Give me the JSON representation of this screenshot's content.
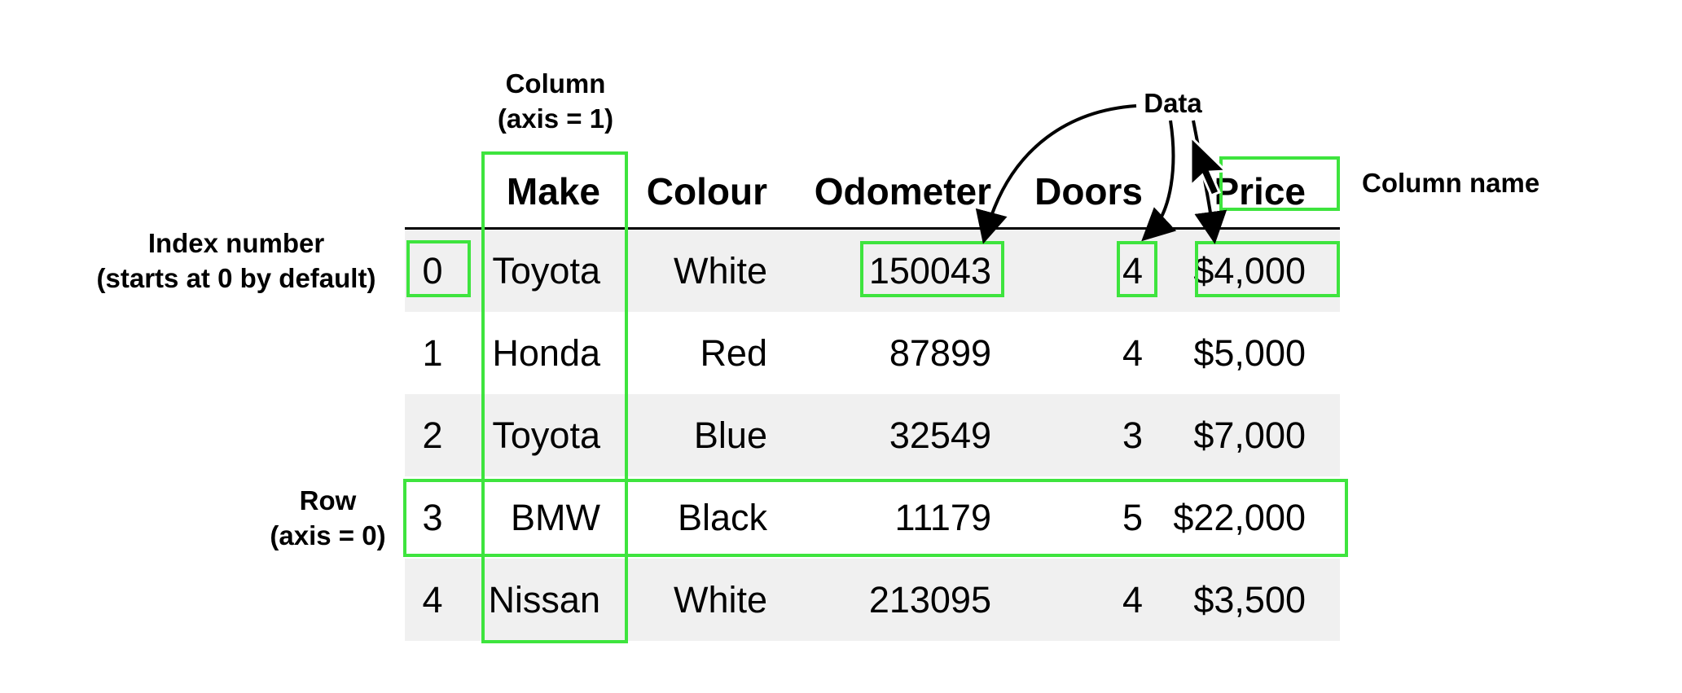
{
  "table": {
    "columns": [
      "Make",
      "Colour",
      "Odometer",
      "Doors",
      "Price"
    ],
    "rows": [
      {
        "index": "0",
        "make": "Toyota",
        "colour": "White",
        "odometer": "150043",
        "doors": "4",
        "price": "$4,000"
      },
      {
        "index": "1",
        "make": "Honda",
        "colour": "Red",
        "odometer": "87899",
        "doors": "4",
        "price": "$5,000"
      },
      {
        "index": "2",
        "make": "Toyota",
        "colour": "Blue",
        "odometer": "32549",
        "doors": "3",
        "price": "$7,000"
      },
      {
        "index": "3",
        "make": "BMW",
        "colour": "Black",
        "odometer": "11179",
        "doors": "5",
        "price": "$22,000"
      },
      {
        "index": "4",
        "make": "Nissan",
        "colour": "White",
        "odometer": "213095",
        "doors": "4",
        "price": "$3,500"
      }
    ]
  },
  "annotations": {
    "column_line1": "Column",
    "column_line2": "(axis = 1)",
    "data": "Data",
    "column_name": "Column name",
    "index_line1": "Index number",
    "index_line2": "(starts at 0 by default)",
    "row_line1": "Row",
    "row_line2": "(axis = 0)"
  },
  "colors": {
    "highlight": "#3ee43e",
    "row_shade": "#f0f0f0",
    "text": "#000000"
  }
}
